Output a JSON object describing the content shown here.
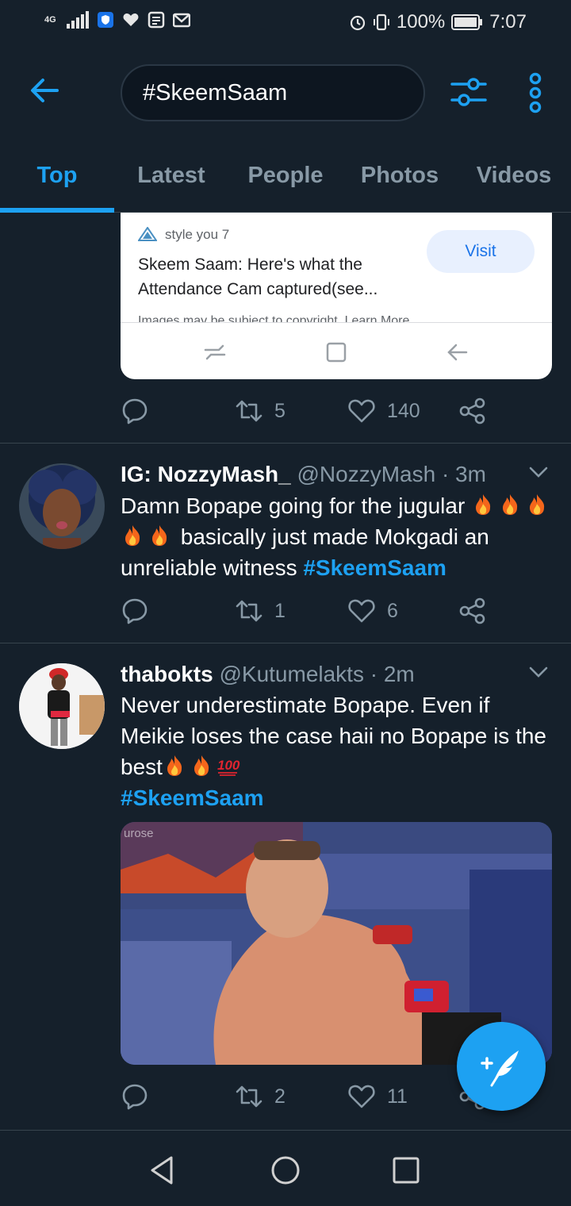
{
  "status_bar": {
    "network": "4G",
    "battery": "100%",
    "time": "7:07"
  },
  "header": {
    "search_value": "#SkeemSaam",
    "back_icon": "arrow-left-icon",
    "filter_icon": "sliders-icon",
    "more_icon": "more-vertical-icon"
  },
  "tabs": [
    {
      "label": "Top",
      "active": true
    },
    {
      "label": "Latest",
      "active": false
    },
    {
      "label": "People",
      "active": false
    },
    {
      "label": "Photos",
      "active": false
    },
    {
      "label": "Videos",
      "active": false
    }
  ],
  "ad_card": {
    "source": "style you 7",
    "title": "Skeem Saam: Here's what the Attendance Cam captured(see...",
    "visit_label": "Visit",
    "copyright": "Images may be subject to copyright. Learn More"
  },
  "tweet0_actions": {
    "replies": "",
    "retweets": "5",
    "likes": "140"
  },
  "tweets": [
    {
      "name": "IG: NozzyMash_",
      "handle": "@NozzyMash · 3m",
      "text_a": "Damn Bopape going for the jugular",
      "text_b": "basically just made Mokgadi an unreliable witness",
      "hashtag": "#SkeemSaam",
      "retweets": "1",
      "likes": "6"
    },
    {
      "name": "thabokts",
      "handle": "@Kutumelakts · 2m",
      "text_a": "Never underestimate Bopape. Even if Meikie loses the case haii no Bopape is the best",
      "hashtag": "#SkeemSaam",
      "retweets": "2",
      "likes": "11",
      "media_watermark": "urose"
    }
  ],
  "colors": {
    "background": "#15202b",
    "accent": "#1da1f2",
    "muted": "#8899a6",
    "divider": "#38444d"
  }
}
